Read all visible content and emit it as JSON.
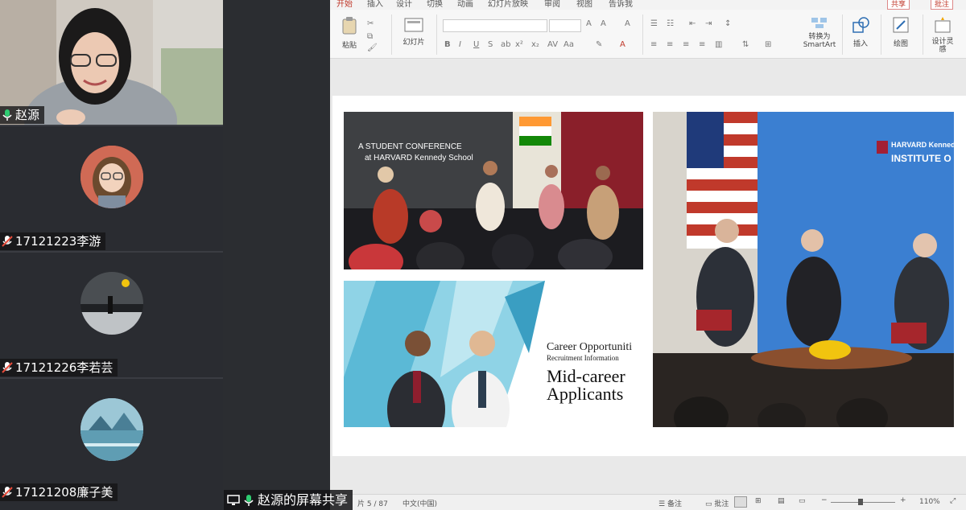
{
  "participants": [
    {
      "name": "赵源",
      "mic": "active"
    },
    {
      "name": "17121223李游",
      "mic": "muted"
    },
    {
      "name": "17121226李若芸",
      "mic": "muted"
    },
    {
      "name": "17121208廉子美",
      "mic": "muted"
    }
  ],
  "screen_share": {
    "label": "赵源的屏幕共享"
  },
  "ppt": {
    "tabs": [
      "开始",
      "插入",
      "设计",
      "切换",
      "动画",
      "幻灯片放映",
      "审阅",
      "视图",
      "告诉我"
    ],
    "share_label": "共享",
    "comment_label": "批注",
    "ribbon": {
      "paste": "粘贴",
      "slides": "幻灯片",
      "smartart": "转换为 SmartArt",
      "insert": "插入",
      "draw": "绘图",
      "designer": "设计灵感"
    },
    "status": {
      "slide_counter": "片 5 / 87",
      "language": "中文(中国)",
      "notes": "备注",
      "comments": "批注",
      "zoom": "110%"
    }
  },
  "slide": {
    "photo1_caption_line1": "A STUDENT CONFERENCE",
    "photo1_caption_line2": "at HARVARD Kennedy School",
    "photo3_line1": "Career Opportuniti",
    "photo3_line2": "Recruitment Information",
    "photo3_line3": "Mid-career",
    "photo3_line4": "Applicants",
    "photo2_logo_line1": "HARVARD Kennedy",
    "photo2_logo_line2": "INSTITUTE O"
  },
  "colors": {
    "mic_active": "#2ecc71",
    "mic_muted": "#e74c3c",
    "accent": "#c0392b"
  }
}
